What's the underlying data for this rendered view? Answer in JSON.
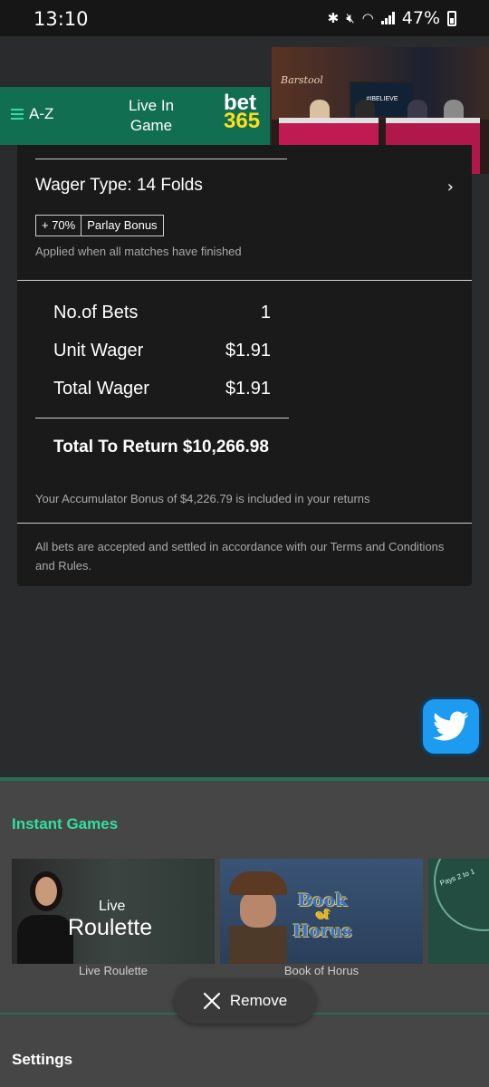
{
  "status_bar": {
    "time": "13:10",
    "battery": "47%",
    "icons": [
      "bluetooth-icon",
      "mute-icon",
      "wifi-icon",
      "signal-icon",
      "battery-icon"
    ]
  },
  "header": {
    "menu_label": "A-Z",
    "live_in_game": "Live In\nGame",
    "logo_top": "bet",
    "logo_bottom": "365"
  },
  "video": {
    "brand": "Barstool",
    "screen_text": "#IBELIEVE"
  },
  "bet_slip": {
    "wager_type": "Wager Type: 14 Folds",
    "bonus_percent": "+ 70%",
    "bonus_label": "Parlay Bonus",
    "applied_note": "Applied when all matches have finished",
    "no_of_bets_label": "No.of Bets",
    "no_of_bets_value": "1",
    "unit_wager_label": "Unit Wager",
    "unit_wager_value": "$1.91",
    "total_wager_label": "Total Wager",
    "total_wager_value": "$1.91",
    "total_to_return": "Total To Return $10,266.98",
    "accumulator_note": "Your Accumulator Bonus of $4,226.79 is included in your returns",
    "terms_note": "All bets are accepted and settled in accordance with our Terms and Conditions and Rules."
  },
  "instant_games": {
    "title": "Instant Games",
    "games": [
      {
        "name": "Live Roulette",
        "art_line1": "Live",
        "art_line2": "Roulette"
      },
      {
        "name": "Book of Horus",
        "art_line1": "Book",
        "art_line2": "of",
        "art_line3": "Horus"
      }
    ],
    "third_tile_text": "Pays 2 to 1"
  },
  "remove_label": "Remove",
  "settings_label": "Settings",
  "colors": {
    "brand_green": "#126e51",
    "accent_green": "#30e0a1",
    "logo_yellow": "#ffdf1b",
    "twitter_blue": "#1d9bf0"
  }
}
